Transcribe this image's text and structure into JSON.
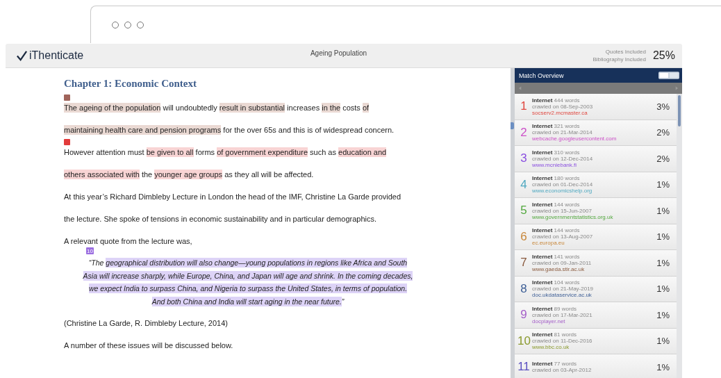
{
  "app": {
    "brand": "iThenticate",
    "title": "Ageing Population",
    "options": [
      "Quotes Included",
      "Bibliography Included"
    ],
    "similarity": "25%"
  },
  "document": {
    "heading": "Chapter 1: Economic Context",
    "blocks": [
      {
        "kind": "para",
        "marker": {
          "color": "#a0645a"
        },
        "lines": [
          [
            {
              "text": "The ageing of the population",
              "color": "#ead9d3"
            },
            {
              "text": " will undoubtedly "
            },
            {
              "text": "result in substantial",
              "color": "#ead9d3"
            },
            {
              "text": " increases "
            },
            {
              "text": "in the",
              "color": "#ead9d3"
            },
            {
              "text": " costs "
            },
            {
              "text": "of",
              "color": "#ead9d3"
            }
          ],
          [
            {
              "text": "maintaining health care and pension programs",
              "color": "#ead9d3"
            },
            {
              "text": " for the over 65s and this is of widespread concern."
            }
          ]
        ]
      },
      {
        "kind": "para",
        "marker": {
          "color": "#e23b3b"
        },
        "lines": [
          [
            {
              "text": "However attention must "
            },
            {
              "text": "be given to all",
              "color": "#f8d4d4"
            },
            {
              "text": " forms "
            },
            {
              "text": "of government expenditure",
              "color": "#f8d4d4"
            },
            {
              "text": " such as "
            },
            {
              "text": "education and",
              "color": "#f8d4d4"
            }
          ],
          [
            {
              "text": "others associated with",
              "color": "#f8d4d4"
            },
            {
              "text": " the "
            },
            {
              "text": "younger age groups",
              "color": "#f8d4d4"
            },
            {
              "text": " as they all will be affected."
            }
          ]
        ]
      },
      {
        "kind": "para",
        "lines": [
          [
            {
              "text": "At this year’s Richard Dimbleby Lecture in London the head of the IMF, Christine La Garde provided"
            }
          ],
          [
            {
              "text": "the lecture.  She spoke of tensions in economic sustainability and in particular demographics."
            }
          ]
        ]
      },
      {
        "kind": "para",
        "lines": [
          [
            {
              "text": "A relevant quote from the lecture was,"
            }
          ]
        ]
      },
      {
        "kind": "quote",
        "marker": {
          "label": "10",
          "color": "#9b6ee0"
        },
        "lines": [
          [
            {
              "text": "“The "
            },
            {
              "text": "geographical distribution will also change—young populations in regions like Africa and South",
              "color": "#ddd3f7"
            }
          ],
          [
            {
              "text": "Asia will increase sharply, while Europe, China, and Japan will age and shrink. In the coming decades,",
              "color": "#ddd3f7"
            }
          ],
          [
            {
              "text": "we expect India to surpass China, and Nigeria to surpass the United States, in terms of population.",
              "color": "#ddd3f7"
            }
          ],
          [
            {
              "text": "And both China and India will start aging in the near future.",
              "color": "#ddd3f7"
            },
            {
              "text": "”"
            }
          ]
        ]
      },
      {
        "kind": "para",
        "lines": [
          [
            {
              "text": "(Christine La Garde, R. Dimbleby Lecture, 2014)"
            }
          ]
        ]
      },
      {
        "kind": "para",
        "lines": [
          [
            {
              "text": "A number of these issues will be discussed below."
            }
          ]
        ]
      }
    ]
  },
  "match_overview": {
    "title": "Match Overview",
    "sources": [
      {
        "number": "1",
        "type": "Internet",
        "words": "444 words",
        "crawled": "crawled on 08-Sep-2003",
        "url": "socserv2.mcmaster.ca",
        "percent": "3%",
        "color": "#e0473f"
      },
      {
        "number": "2",
        "type": "Internet",
        "words": "321 words",
        "crawled": "crawled on 21-Mar-2014",
        "url": "webcache.googleusercontent.com",
        "percent": "2%",
        "color": "#cc4fc8"
      },
      {
        "number": "3",
        "type": "Internet",
        "words": "310 words",
        "crawled": "crawled on 12-Dec-2014",
        "url": "www.mcniebank.fi",
        "percent": "2%",
        "color": "#8a4fe0"
      },
      {
        "number": "4",
        "type": "Internet",
        "words": "180 words",
        "crawled": "crawled on 01-Dec-2014",
        "url": "www.economicshelp.org",
        "percent": "1%",
        "color": "#4fa8c0"
      },
      {
        "number": "5",
        "type": "Internet",
        "words": "144 words",
        "crawled": "crawled on 15-Jun-2007",
        "url": "www.governmentstatistics.org.uk",
        "percent": "1%",
        "color": "#52a83e"
      },
      {
        "number": "6",
        "type": "Internet",
        "words": "144 words",
        "crawled": "crawled on 13-Aug-2007",
        "url": "ec.europa.eu",
        "percent": "1%",
        "color": "#c8873a"
      },
      {
        "number": "7",
        "type": "Internet",
        "words": "141 words",
        "crawled": "crawled on 09-Jan-2011",
        "url": "www.gaeda.stir.ac.uk",
        "percent": "1%",
        "color": "#8a5a3e"
      },
      {
        "number": "8",
        "type": "Internet",
        "words": "104 words",
        "crawled": "crawled on 21-May-2019",
        "url": "doc.ukdataservice.ac.uk",
        "percent": "1%",
        "color": "#3e5f96"
      },
      {
        "number": "9",
        "type": "Internet",
        "words": "89 words",
        "crawled": "crawled on 17-Mar-2021",
        "url": "docplayer.net",
        "percent": "1%",
        "color": "#a45ec8"
      },
      {
        "number": "10",
        "type": "Internet",
        "words": "81 words",
        "crawled": "crawled on 11-Dec-2016",
        "url": "www.bbc.co.uk",
        "percent": "1%",
        "color": "#8a9a2e"
      },
      {
        "number": "11",
        "type": "Internet",
        "words": "77 words",
        "crawled": "crawled on 03-Apr-2012",
        "percent": "1%",
        "color": "#5a4fc0"
      }
    ]
  }
}
